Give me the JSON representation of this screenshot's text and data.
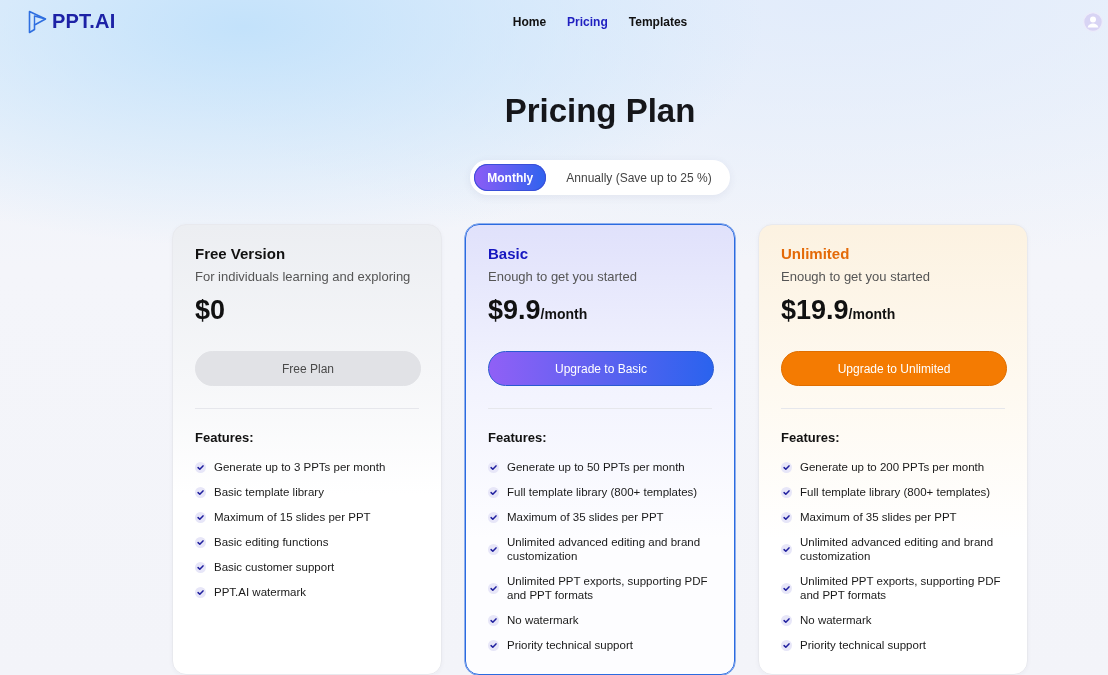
{
  "header": {
    "logo": "PPT.AI",
    "nav": [
      {
        "label": "Home",
        "selected": false
      },
      {
        "label": "Pricing",
        "selected": true
      },
      {
        "label": "Templates",
        "selected": false
      }
    ]
  },
  "title": "Pricing Plan",
  "billing_toggle": [
    {
      "label": "Monthly",
      "selected": true
    },
    {
      "label": "Annually (Save up to 25 %)",
      "selected": false
    }
  ],
  "plans": [
    {
      "kind": "free",
      "selected": false,
      "name": "Free Version",
      "tagline": "For individuals learning and exploring",
      "price": "$0",
      "button": "Free Plan",
      "features_heading": "Features:",
      "features": [
        "Generate up to 3 PPTs per month",
        "Basic template library",
        "Maximum of 15 slides per PPT",
        "Basic editing functions",
        "Basic customer support",
        "PPT.AI watermark"
      ]
    },
    {
      "kind": "basic",
      "selected": true,
      "name": "Basic",
      "tagline": "Enough to get you started",
      "price": "$9.9",
      "period": "/month",
      "button": "Upgrade to Basic",
      "features_heading": "Features:",
      "features": [
        "Generate up to 50 PPTs per month",
        "Full template library (800+ templates)",
        "Maximum of 35 slides per PPT",
        "Unlimited advanced editing and brand customization",
        "Unlimited PPT exports, supporting PDF and PPT formats",
        "No watermark",
        "Priority technical support"
      ]
    },
    {
      "kind": "unlimited",
      "selected": false,
      "name": "Unlimited",
      "tagline": "Enough to get you started",
      "price": "$19.9",
      "period": "/month",
      "button": "Upgrade to Unlimited",
      "features_heading": "Features:",
      "features": [
        "Generate up to 200 PPTs per month",
        "Full template library (800+ templates)",
        "Maximum of 35 slides per PPT",
        "Unlimited advanced editing and brand customization",
        "Unlimited PPT exports, supporting PDF and PPT formats",
        "No watermark",
        "Priority technical support"
      ]
    }
  ]
}
